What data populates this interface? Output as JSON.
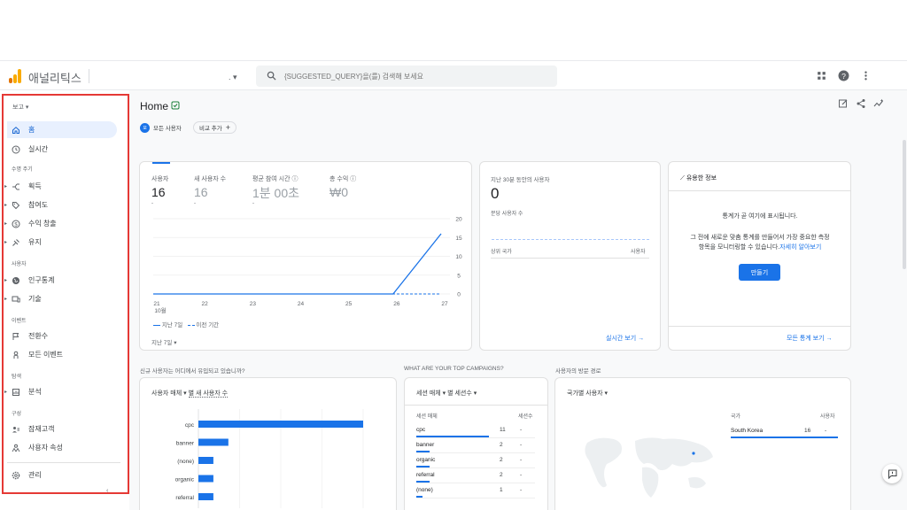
{
  "app": {
    "title": "애널리틱스",
    "account_dots": ". ▾"
  },
  "search": {
    "placeholder": "{SUGGESTED_QUERY}을(를) 검색해 보세요"
  },
  "colors": {
    "accent": "#1a73e8",
    "sidebar_active_bg": "#e8f0fe",
    "highlight_frame": "#e53935",
    "logo_orange": "#f9ab00",
    "logo_dark": "#e37400"
  },
  "sidebar": {
    "report_label": "보고",
    "items": [
      {
        "label": "홈",
        "icon": "home-icon",
        "active": true
      },
      {
        "label": "실시간",
        "icon": "clock-icon"
      }
    ],
    "sections": [
      {
        "title": "수명 주기",
        "items": [
          {
            "label": "획득",
            "icon": "acquisition-icon"
          },
          {
            "label": "참여도",
            "icon": "tag-icon"
          },
          {
            "label": "수익 창출",
            "icon": "dollar-icon"
          },
          {
            "label": "유지",
            "icon": "retention-icon"
          }
        ]
      },
      {
        "title": "사용자",
        "items": [
          {
            "label": "인구통계",
            "icon": "globe-icon"
          },
          {
            "label": "기술",
            "icon": "devices-icon"
          }
        ]
      },
      {
        "title": "이벤트",
        "items": [
          {
            "label": "전환수",
            "icon": "flag-icon"
          },
          {
            "label": "모든 이벤트",
            "icon": "touch-icon"
          }
        ]
      },
      {
        "title": "탐색",
        "items": [
          {
            "label": "분석",
            "icon": "analysis-icon"
          }
        ]
      },
      {
        "title": "구성",
        "items": [
          {
            "label": "잠재고객",
            "icon": "audience-icon"
          },
          {
            "label": "사용자 속성",
            "icon": "user-property-icon"
          }
        ]
      }
    ],
    "admin_label": "관리"
  },
  "header": {
    "title": "Home"
  },
  "filters": {
    "all_users": "모든 사용자",
    "compare": "비교 추가"
  },
  "overview": {
    "metrics": [
      {
        "label": "사용자",
        "value": "16",
        "sub": "-"
      },
      {
        "label": "새 사용자 수",
        "value": "16",
        "sub": "-"
      },
      {
        "label": "평균 참여 시간",
        "value": "1분 00초",
        "sub": "-"
      },
      {
        "label": "총 수익",
        "value": "₩0",
        "sub": ""
      }
    ],
    "legend_current": "지난 7일",
    "legend_previous": "이전 기간",
    "date_range": "지난 7일"
  },
  "chart_data": {
    "type": "line",
    "x": [
      "21",
      "22",
      "23",
      "24",
      "25",
      "26",
      "27"
    ],
    "x_sublabel": "10월",
    "series": [
      {
        "name": "지난 7일",
        "values": [
          0,
          0,
          0,
          0,
          0,
          0,
          16
        ]
      },
      {
        "name": "이전 기간",
        "values": [
          0,
          0,
          0,
          0,
          0,
          0,
          0
        ]
      }
    ],
    "yticks": [
      "20",
      "15",
      "10",
      "5",
      "0"
    ],
    "ylim": [
      0,
      20
    ]
  },
  "realtime": {
    "title": "지난 30분 동안의 사용자",
    "value": "0",
    "per_minute": "분당 사용자 수",
    "col_country": "상위 국가",
    "col_users": "사용자",
    "link": "실시간 보기"
  },
  "insights": {
    "title": "유용한 정보",
    "line1": "통계가 곧 여기에 표시됩니다.",
    "line2": "그 전에 새로운 맞춤 통계를 만들어서 가장 중요한 측정",
    "line3": "항목을 모니터링할 수 있습니다.",
    "learn_more": "자세히 알아보기",
    "create_button": "만들기",
    "link": "모든 통계 보기"
  },
  "section_questions": {
    "acquisition": "신규 사용자는 어디에서 유입되고 있습니까?",
    "campaigns": "WHAT ARE YOUR TOP CAMPAIGNS?",
    "visit_path": "사용자의 방문 경로"
  },
  "new_users_card": {
    "dropdown1": "사용자 매체 ▾",
    "dropdown2": "별 새 사용자 수",
    "bar_chart": {
      "type": "bar",
      "categories": [
        "cpc",
        "banner",
        "(none)",
        "organic",
        "referral"
      ],
      "values": [
        11,
        2,
        1,
        1,
        1
      ]
    }
  },
  "campaigns_card": {
    "dropdown": "세션 매체 ▾ 별 세션수 ▾",
    "col_medium": "세션 매체",
    "col_sessions": "세션수",
    "rows": [
      {
        "label": "cpc",
        "value": "11",
        "change": "-",
        "share": 1.0
      },
      {
        "label": "banner",
        "value": "2",
        "change": "-",
        "share": 0.18
      },
      {
        "label": "organic",
        "value": "2",
        "change": "-",
        "share": 0.18
      },
      {
        "label": "referral",
        "value": "2",
        "change": "-",
        "share": 0.18
      },
      {
        "label": "(none)",
        "value": "1",
        "change": "-",
        "share": 0.09
      }
    ]
  },
  "country_card": {
    "dropdown": "국가별 사용자 ▾",
    "col_country": "국가",
    "col_users": "사용자",
    "rows": [
      {
        "label": "South Korea",
        "value": "16",
        "change": "-"
      }
    ]
  }
}
